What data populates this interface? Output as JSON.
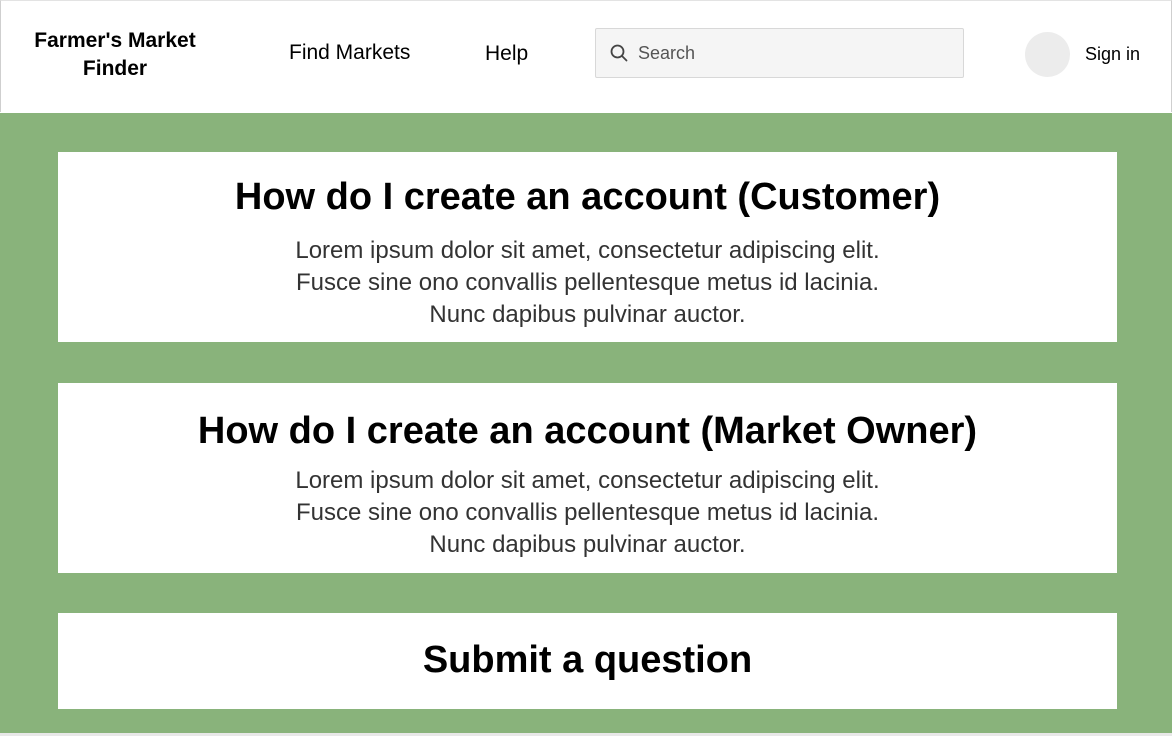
{
  "header": {
    "logo_line1": "Farmer's Market",
    "logo_line2": "Finder",
    "nav": {
      "find_markets": "Find Markets",
      "help": "Help"
    },
    "search": {
      "placeholder": "Search",
      "value": ""
    },
    "sign_in": "Sign in"
  },
  "faq": [
    {
      "title": "How do I create an account (Customer)",
      "lines": [
        "Lorem ipsum dolor sit amet, consectetur adipiscing elit.",
        "Fusce sine ono convallis pellentesque metus id lacinia.",
        "Nunc dapibus pulvinar auctor."
      ]
    },
    {
      "title": "How do I create an account (Market Owner)",
      "lines": [
        "Lorem ipsum dolor sit amet, consectetur adipiscing elit.",
        "Fusce sine ono convallis pellentesque metus id lacinia.",
        "Nunc dapibus pulvinar auctor."
      ]
    }
  ],
  "submit": {
    "title": "Submit a question"
  },
  "colors": {
    "background": "#89b37b",
    "card": "#ffffff"
  },
  "icons": {
    "search": "search-icon",
    "avatar": "avatar"
  }
}
